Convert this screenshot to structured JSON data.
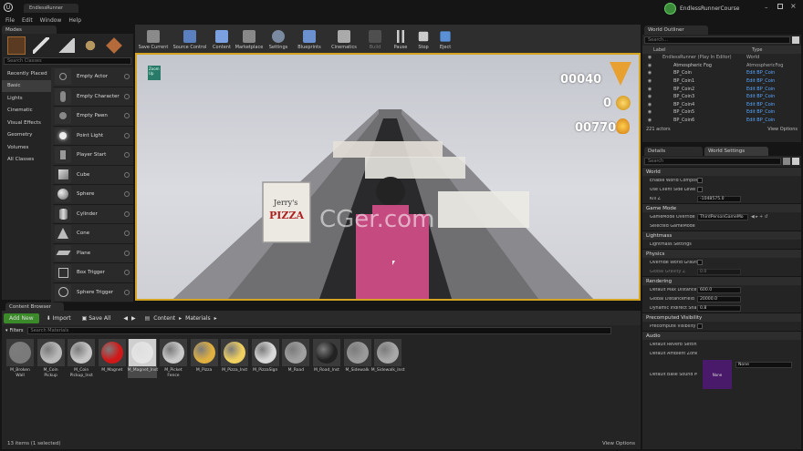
{
  "menu": [
    "File",
    "Edit",
    "Window",
    "Help"
  ],
  "tab_title": "EndlessRunner",
  "project_name": "EndlessRunnerCourse",
  "modes": {
    "tab": "Modes",
    "search_placeholder": "Search Classes",
    "categories": [
      "Recently Placed",
      "Basic",
      "Lights",
      "Cinematic",
      "Visual Effects",
      "Geometry",
      "Volumes",
      "All Classes"
    ],
    "items": [
      "Empty Actor",
      "Empty Character",
      "Empty Pawn",
      "Point Light",
      "Player Start",
      "Cube",
      "Sphere",
      "Cylinder",
      "Cone",
      "Plane",
      "Box Trigger",
      "Sphere Trigger"
    ]
  },
  "toolbar": [
    "Save Current",
    "Source Control",
    "Content",
    "Marketplace",
    "Settings",
    "Blueprints",
    "Cinematics",
    "Build",
    "Pause",
    "Stop",
    "Eject"
  ],
  "viewport": {
    "score": "00040",
    "coins": "0",
    "distance": "00770",
    "hud_label": "Zoom Up",
    "sign_line1": "Jerry's",
    "sign_line2": "PIZZA",
    "watermark": "CGer.com"
  },
  "outliner": {
    "tab": "World Outliner",
    "search_placeholder": "Search...",
    "col_label": "Label",
    "col_type": "Type",
    "rows": [
      {
        "label": "EndlessRunner (Play In Editor)",
        "type": "World"
      },
      {
        "label": "Atmospheric Fog",
        "type": "AtmosphericFog"
      },
      {
        "label": "BP_Coin",
        "type": "Edit BP_Coin"
      },
      {
        "label": "BP_Coin1",
        "type": "Edit BP_Coin"
      },
      {
        "label": "BP_Coin2",
        "type": "Edit BP_Coin"
      },
      {
        "label": "BP_Coin3",
        "type": "Edit BP_Coin"
      },
      {
        "label": "BP_Coin4",
        "type": "Edit BP_Coin"
      },
      {
        "label": "BP_Coin5",
        "type": "Edit BP_Coin"
      },
      {
        "label": "BP_Coin6",
        "type": "Edit BP_Coin"
      }
    ],
    "count": "221 actors",
    "view_options": "View Options"
  },
  "details": {
    "tab": "Details",
    "tab2": "World Settings",
    "search_placeholder": "Search",
    "sections": [
      {
        "title": "World",
        "props": [
          {
            "name": "Enable World Composi",
            "kind": "check"
          },
          {
            "name": "Use Client Side Level",
            "kind": "check"
          },
          {
            "name": "Kill Z",
            "kind": "value",
            "value": "-1048575.0"
          }
        ]
      },
      {
        "title": "Game Mode",
        "props": [
          {
            "name": "GameMode Override",
            "kind": "select",
            "value": "ThirdPersonGameMo"
          },
          {
            "name": "Selected GameMode",
            "kind": "none"
          }
        ]
      },
      {
        "title": "Lightmass",
        "props": [
          {
            "name": "Lightmass Settings",
            "kind": "none"
          }
        ]
      },
      {
        "title": "Physics",
        "props": [
          {
            "name": "Override World Gravity",
            "kind": "check"
          },
          {
            "name": "Global Gravity Z",
            "kind": "value",
            "value": "0.0"
          }
        ]
      },
      {
        "title": "Rendering",
        "props": [
          {
            "name": "Default Max Distance",
            "kind": "value",
            "value": "600.0"
          },
          {
            "name": "Global DistanceField",
            "kind": "value",
            "value": "20000.0"
          },
          {
            "name": "Dynamic Indirect Sha",
            "kind": "value",
            "value": "0.8"
          }
        ]
      },
      {
        "title": "Precomputed Visibility",
        "props": [
          {
            "name": "Precompute Visibility",
            "kind": "check"
          }
        ]
      },
      {
        "title": "Audio",
        "props": [
          {
            "name": "Default Reverb Settin",
            "kind": "none"
          },
          {
            "name": "Default Ambient Zone",
            "kind": "none"
          }
        ]
      }
    ],
    "sound_label": "Default Base Sound M",
    "sound_value": "None",
    "sound_thumb": "None"
  },
  "content": {
    "tab": "Content Browser",
    "add_new": "Add New",
    "import": "Import",
    "save_all": "Save All",
    "path": [
      "Content",
      "Materials"
    ],
    "filters": "Filters",
    "search_placeholder": "Search Materials",
    "assets": [
      {
        "name": "M_Broken Wall",
        "color": "#7a7a7a"
      },
      {
        "name": "M_Coin Pickup",
        "color": "#b8b8b8"
      },
      {
        "name": "M_Coin Pickup_Inst",
        "color": "#c4c4c4"
      },
      {
        "name": "M_Magnet",
        "color": "#d01818"
      },
      {
        "name": "M_Magnet_Inst",
        "color": "#e4e4e4"
      },
      {
        "name": "M_Picket Fence",
        "color": "#c8c8c8"
      },
      {
        "name": "M_Pizza",
        "color": "#e0b040"
      },
      {
        "name": "M_Pizza_Inst",
        "color": "#f0d060"
      },
      {
        "name": "M_PizzaSign",
        "color": "#d8d8d8"
      },
      {
        "name": "M_Road",
        "color": "#a0a0a0"
      },
      {
        "name": "M_Road_Inst",
        "color": "#222222"
      },
      {
        "name": "M_Sidewalk",
        "color": "#9a9a9a"
      },
      {
        "name": "M_Sidewalk_Inst",
        "color": "#a8a8a8"
      }
    ],
    "status": "13 items (1 selected)",
    "view_options": "View Options"
  }
}
